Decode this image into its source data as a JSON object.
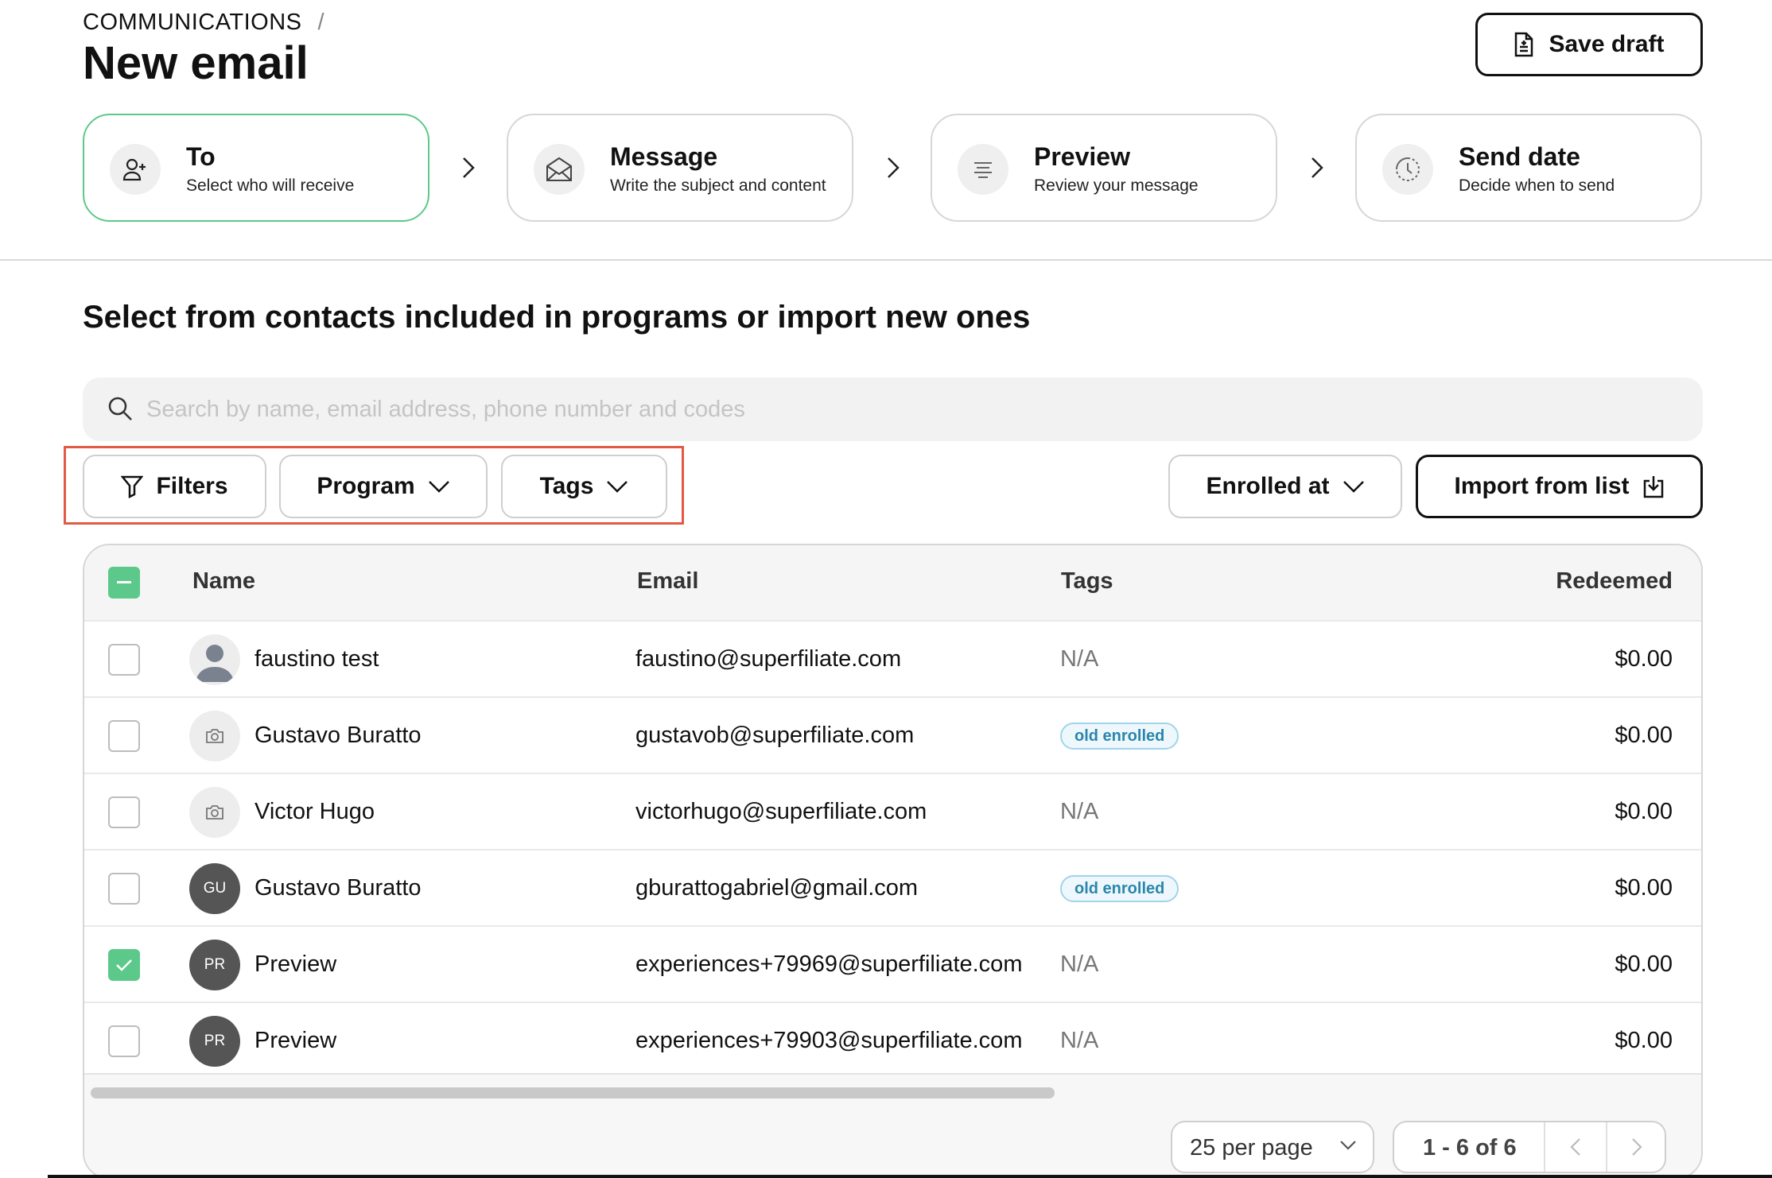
{
  "header": {
    "breadcrumb": "COMMUNICATIONS",
    "breadcrumb_sep": "/",
    "title": "New email",
    "save_label": "Save draft"
  },
  "steps": [
    {
      "title": "To",
      "desc": "Select who will receive",
      "icon": "add-user-icon",
      "active": true
    },
    {
      "title": "Message",
      "desc": "Write the subject and content",
      "icon": "envelope-icon",
      "active": false
    },
    {
      "title": "Preview",
      "desc": "Review your message",
      "icon": "lines-icon",
      "active": false
    },
    {
      "title": "Send date",
      "desc": "Decide when to send",
      "icon": "clock-icon",
      "active": false
    }
  ],
  "section": {
    "title": "Select from contacts included in programs or import new ones"
  },
  "search": {
    "placeholder": "Search by name, email address, phone number and codes"
  },
  "toolbar": {
    "filters": "Filters",
    "program": "Program",
    "tags": "Tags",
    "enrolled": "Enrolled at",
    "import": "Import from list"
  },
  "table": {
    "headers": {
      "name": "Name",
      "email": "Email",
      "tags": "Tags",
      "redeemed": "Redeemed"
    },
    "rows": [
      {
        "name": "faustino test",
        "email": "faustino@superfiliate.com",
        "tag": "N/A",
        "amount": "$0.00",
        "avatar": "person",
        "checked": false
      },
      {
        "name": "Gustavo Buratto",
        "email": "gustavob@superfiliate.com",
        "tag": "old enrolled",
        "amount": "$0.00",
        "avatar": "camera",
        "checked": false
      },
      {
        "name": "Victor Hugo",
        "email": "victorhugo@superfiliate.com",
        "tag": "N/A",
        "amount": "$0.00",
        "avatar": "camera",
        "checked": false
      },
      {
        "name": "Gustavo Buratto",
        "email": "gburattogabriel@gmail.com",
        "tag": "old enrolled",
        "amount": "$0.00",
        "avatar": "GU",
        "checked": false
      },
      {
        "name": "Preview",
        "email": "experiences+79969@superfiliate.com",
        "tag": "N/A",
        "amount": "$0.00",
        "avatar": "PR",
        "checked": true
      },
      {
        "name": "Preview",
        "email": "experiences+79903@superfiliate.com",
        "tag": "N/A",
        "amount": "$0.00",
        "avatar": "PR",
        "checked": false
      }
    ]
  },
  "pagination": {
    "per_page": "25 per page",
    "range": "1 - 6 of 6"
  },
  "colors": {
    "accent_green": "#5cc98a",
    "highlight_red": "#e25a45",
    "tag_blue": "#2a86ad"
  }
}
